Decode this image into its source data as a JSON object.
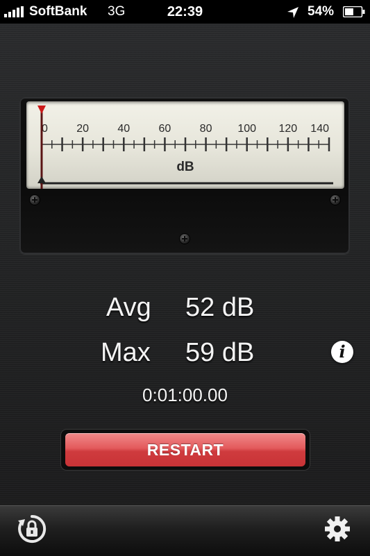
{
  "status_bar": {
    "carrier": "SoftBank",
    "network": "3G",
    "time": "22:39",
    "battery_percent": "54%",
    "battery_level": 0.54
  },
  "meter": {
    "ticks": [
      "0",
      "20",
      "40",
      "60",
      "80",
      "100",
      "120",
      "140"
    ],
    "unit": "dB",
    "needle_value": 0,
    "peak_marker_value": 0
  },
  "readout": {
    "avg_label": "Avg",
    "avg_value": "52 dB",
    "max_label": "Max",
    "max_value": "59 dB",
    "elapsed": "0:01:00.00",
    "info_glyph": "i"
  },
  "actions": {
    "restart_label": "RESTART"
  },
  "toolbar": {
    "left_icon": "rotation-lock-icon",
    "right_icon": "gear-icon"
  },
  "colors": {
    "restart_button": "#d9474a",
    "meter_face": "#e8e7dc",
    "needle": "#cc1a1a"
  }
}
